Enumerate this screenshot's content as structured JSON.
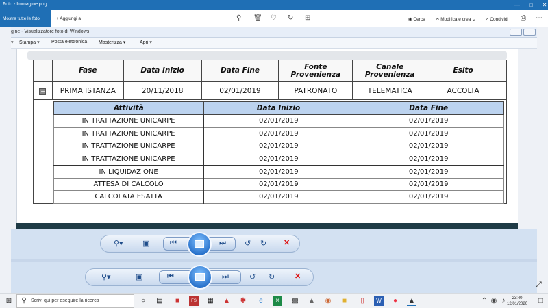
{
  "photos_app": {
    "title": "Foto - Immagine.png",
    "show_all": "Mostra tutte le foto",
    "add_to": "Aggiungi a",
    "search": "Cerca",
    "edit_create": "Modifica e crea",
    "share": "Condividi"
  },
  "viewer": {
    "title": "gine - Visualizzatore foto di Windows",
    "menu": [
      "Stampa",
      "Posta elettronica",
      "Masterizza",
      "Apri"
    ]
  },
  "main_table": {
    "headers": [
      "Fase",
      "Data Inizio",
      "Data Fine",
      "Fonte Provenienza",
      "Canale Provenienza",
      "Esito"
    ],
    "row": [
      "PRIMA ISTANZA",
      "20/11/2018",
      "02/01/2019",
      "PATRONATO",
      "TELEMATICA",
      "ACCOLTA"
    ]
  },
  "sub_table": {
    "headers": [
      "Attività",
      "Data Inizio",
      "Data Fine"
    ],
    "rows": [
      [
        "IN TRATTAZIONE UNICARPE",
        "02/01/2019",
        "02/01/2019"
      ],
      [
        "IN TRATTAZIONE UNICARPE",
        "02/01/2019",
        "02/01/2019"
      ],
      [
        "IN TRATTAZIONE UNICARPE",
        "02/01/2019",
        "02/01/2019"
      ],
      [
        "IN TRATTAZIONE UNICARPE",
        "02/01/2019",
        "02/01/2019"
      ],
      [
        "IN LIQUIDAZIONE",
        "02/01/2019",
        "02/01/2019"
      ],
      [
        "ATTESA DI CALCOLO",
        "02/01/2019",
        "02/01/2019"
      ],
      [
        "CALCOLATA ESATTA",
        "02/01/2019",
        "02/01/2019"
      ]
    ]
  },
  "taskbar": {
    "search_placeholder": "Scrivi qui per eseguire la ricerca",
    "time": "23:40",
    "date": "12/01/2020"
  }
}
